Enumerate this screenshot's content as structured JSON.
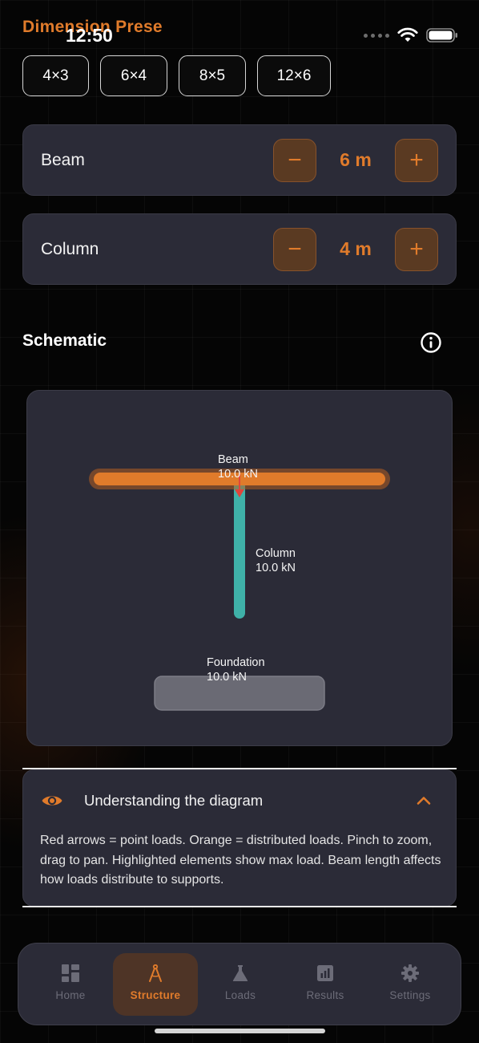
{
  "status_bar": {
    "time": "12:50"
  },
  "presets_section": {
    "heading": "Dimension Prese",
    "presets": [
      "4×3",
      "6×4",
      "8×5",
      "12×6"
    ]
  },
  "dimensions": {
    "beam": {
      "label": "Beam",
      "value": "6 m",
      "minus": "−",
      "plus": "+"
    },
    "column": {
      "label": "Column",
      "value": "4 m",
      "minus": "−",
      "plus": "+"
    }
  },
  "schematic": {
    "title": "Schematic",
    "beam": {
      "name": "Beam",
      "load": "10.0 kN"
    },
    "column": {
      "name": "Column",
      "load": "10.0 kN"
    },
    "foundation": {
      "name": "Foundation",
      "load": "10.0 kN"
    },
    "colors": {
      "beam": "#e07b2b",
      "column": "#3fb1a8",
      "point_load": "#e0453a",
      "foundation": "#6a6a74"
    }
  },
  "understanding": {
    "title": "Understanding the diagram",
    "body": "Red arrows = point loads. Orange = distributed loads. Pinch to zoom, drag to pan. Highlighted elements show max load. Beam length affects how loads distribute to supports."
  },
  "tabbar": {
    "tabs": [
      {
        "label": "Home",
        "icon": "grid-icon"
      },
      {
        "label": "Structure",
        "icon": "compass-icon",
        "active": true
      },
      {
        "label": "Loads",
        "icon": "flask-icon"
      },
      {
        "label": "Results",
        "icon": "bar-chart-icon"
      },
      {
        "label": "Settings",
        "icon": "gear-icon"
      }
    ]
  },
  "theme": {
    "accent": "#e07b2b",
    "card": "#2b2b37",
    "background": "#050505"
  }
}
